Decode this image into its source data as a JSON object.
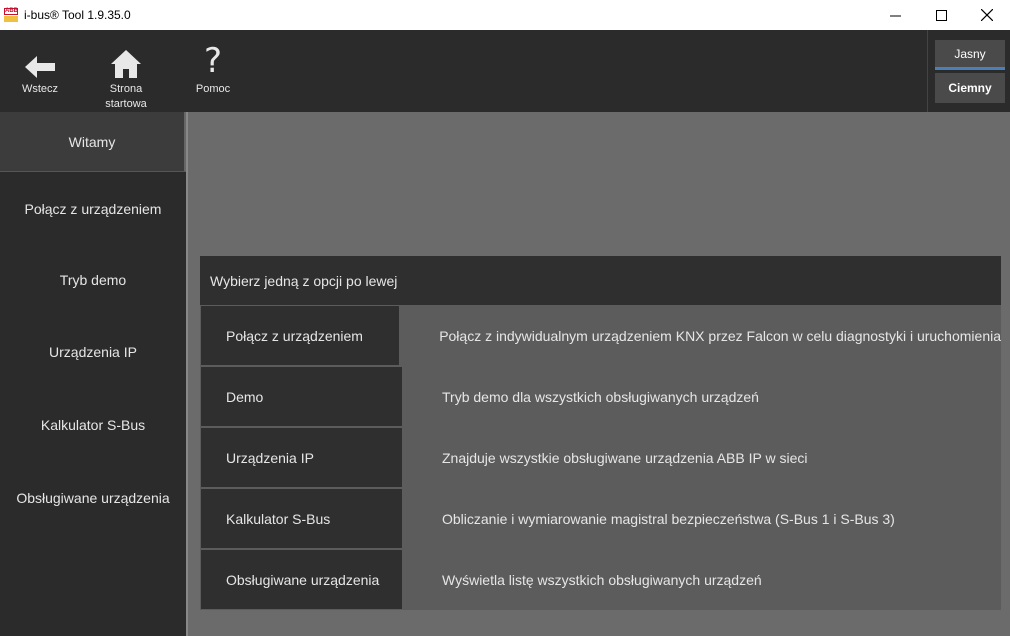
{
  "window": {
    "title": "i-bus® Tool 1.9.35.0",
    "logo_text": "ABB",
    "minimize_glyph": "—",
    "maximize_glyph": "☐",
    "close_glyph": "✕"
  },
  "toolbar": {
    "back_label": "Wstecz",
    "home_label_line1": "Strona",
    "home_label_line2": "startowa",
    "help_label": "Pomoc",
    "help_glyph": "?"
  },
  "theme": {
    "light_label": "Jasny",
    "dark_label": "Ciemny",
    "selected": "Ciemny"
  },
  "sidebar": {
    "items": [
      {
        "label": "Witamy"
      },
      {
        "label": "Połącz z urządzeniem"
      },
      {
        "label": "Tryb demo"
      },
      {
        "label": "Urządzenia IP"
      },
      {
        "label": "Kalkulator S-Bus"
      },
      {
        "label": "Obsługiwane urządzenia"
      }
    ],
    "active": "Witamy"
  },
  "main": {
    "header": "Wybierz jedną z opcji po lewej",
    "rows": [
      {
        "name": "Połącz z urządzeniem",
        "desc": "Połącz z indywidualnym urządzeniem KNX przez Falcon w celu diagnostyki i uruchomienia"
      },
      {
        "name": "Demo",
        "desc": "Tryb demo dla wszystkich obsługiwanych urządzeń"
      },
      {
        "name": "Urządzenia IP",
        "desc": "Znajduje wszystkie obsługiwane urządzenia ABB IP w sieci"
      },
      {
        "name": "Kalkulator S-Bus",
        "desc": "Obliczanie i wymiarowanie magistral bezpieczeństwa (S-Bus 1 i S-Bus 3)"
      },
      {
        "name": "Obsługiwane urządzenia",
        "desc": "Wyświetla listę wszystkich obsługiwanych urządzeń"
      }
    ]
  },
  "colors": {
    "toolbar_bg": "#2b2b2b",
    "content_bg": "#6b6b6b",
    "accent": "#4a7fb8"
  }
}
